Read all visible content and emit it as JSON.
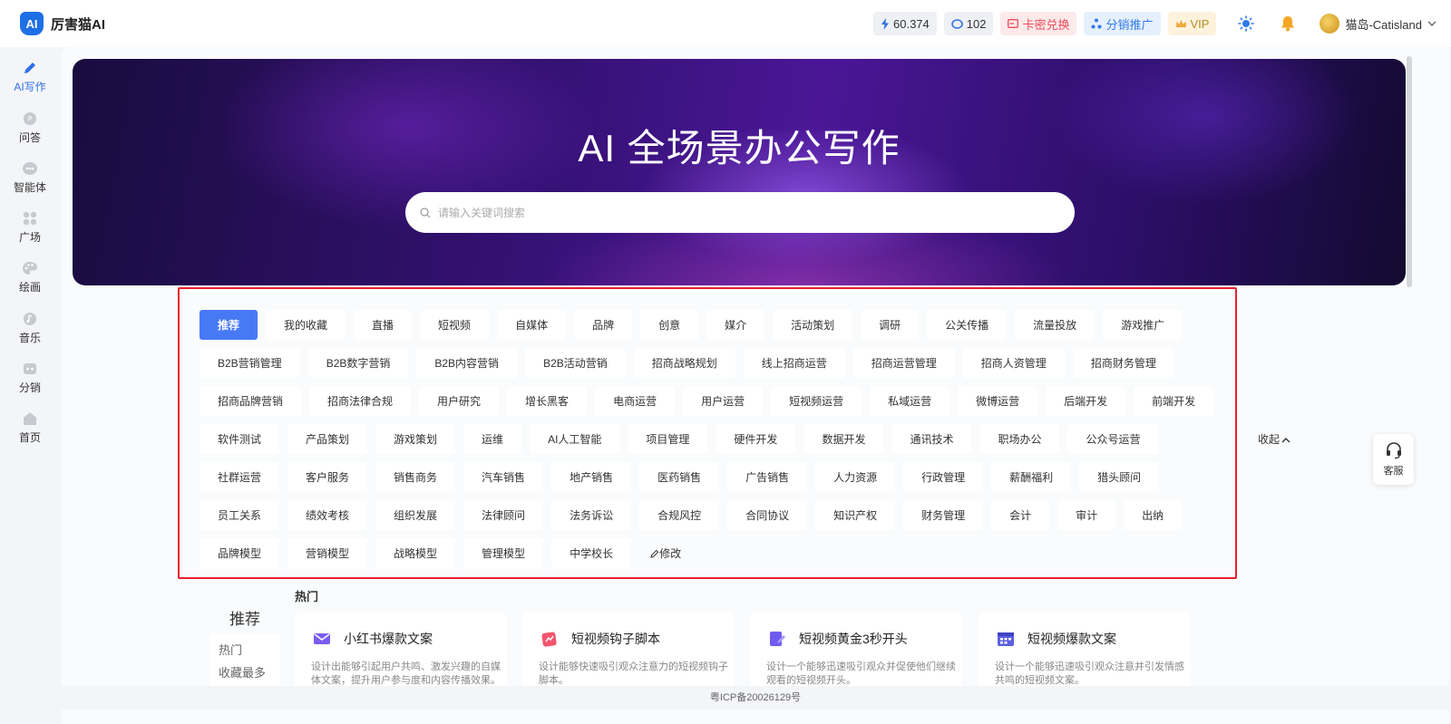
{
  "app": {
    "name": "厉害猫AI",
    "logo_text": "AI"
  },
  "header": {
    "points": "60.374",
    "tokens": "102",
    "redeem": "卡密兑换",
    "affiliate": "分销推广",
    "vip": "VIP",
    "username": "猫岛-Catisland"
  },
  "sidebar": {
    "items": [
      {
        "label": "AI写作",
        "icon": "pencil-icon",
        "active": true
      },
      {
        "label": "问答",
        "icon": "chat-icon"
      },
      {
        "label": "智能体",
        "icon": "bot-icon"
      },
      {
        "label": "广场",
        "icon": "grid-icon"
      },
      {
        "label": "绘画",
        "icon": "palette-icon"
      },
      {
        "label": "音乐",
        "icon": "music-icon"
      },
      {
        "label": "分销",
        "icon": "share-icon"
      },
      {
        "label": "首页",
        "icon": "home-icon"
      }
    ]
  },
  "hero": {
    "title": "AI 全场景办公写作",
    "search_placeholder": "请输入关键词搜索"
  },
  "tags": [
    "推荐",
    "我的收藏",
    "直播",
    "短视频",
    "自媒体",
    "品牌",
    "创意",
    "媒介",
    "活动策划",
    "调研",
    "公关传播",
    "流量投放",
    "游戏推广",
    "B2B营销管理",
    "B2B数字营销",
    "B2B内容营销",
    "B2B活动营销",
    "招商战略规划",
    "线上招商运营",
    "招商运营管理",
    "招商人资管理",
    "招商财务管理",
    "招商品牌营销",
    "招商法律合规",
    "用户研究",
    "增长黑客",
    "电商运营",
    "用户运营",
    "短视频运营",
    "私域运营",
    "微博运营",
    "后端开发",
    "前端开发",
    "软件测试",
    "产品策划",
    "游戏策划",
    "运维",
    "AI人工智能",
    "项目管理",
    "硬件开发",
    "数据开发",
    "通讯技术",
    "职场办公",
    "公众号运营",
    "社群运营",
    "客户服务",
    "销售商务",
    "汽车销售",
    "地产销售",
    "医药销售",
    "广告销售",
    "人力资源",
    "行政管理",
    "薪酬福利",
    "猎头顾问",
    "员工关系",
    "绩效考核",
    "组织发展",
    "法律顾问",
    "法务诉讼",
    "合规风控",
    "合同协议",
    "知识产权",
    "财务管理",
    "会计",
    "审计",
    "出纳",
    "品牌模型",
    "营销模型",
    "战略模型",
    "管理模型",
    "中学校长"
  ],
  "edit_tag": "修改",
  "collapse_label": "收起",
  "recommend": {
    "title": "推荐",
    "items": [
      "热门",
      "收藏最多"
    ]
  },
  "hot_label": "热门",
  "cards": [
    {
      "title": "小红书爆款文案",
      "desc": "设计出能够引起用户共鸣、激发兴趣的自媒体文案，提升用户参与度和内容传播效果。",
      "icon": "mail-icon",
      "color": "#7b5cf0"
    },
    {
      "title": "短视频钩子脚本",
      "desc": "设计能够快速吸引观众注意力的短视频钩子脚本。",
      "icon": "clip-icon",
      "color": "#f2566e"
    },
    {
      "title": "短视频黄金3秒开头",
      "desc": "设计一个能够迅速吸引观众并促使他们继续观看的短视频开头。",
      "icon": "edit-doc-icon",
      "color": "#6e5cf0"
    },
    {
      "title": "短视频爆款文案",
      "desc": "设计一个能够迅速吸引观众注意并引发情感共鸣的短视频文案。",
      "icon": "calendar-icon",
      "color": "#5b5fe0"
    }
  ],
  "footer": {
    "icp": "粤ICP备20026129号"
  },
  "service": {
    "label": "客服"
  }
}
